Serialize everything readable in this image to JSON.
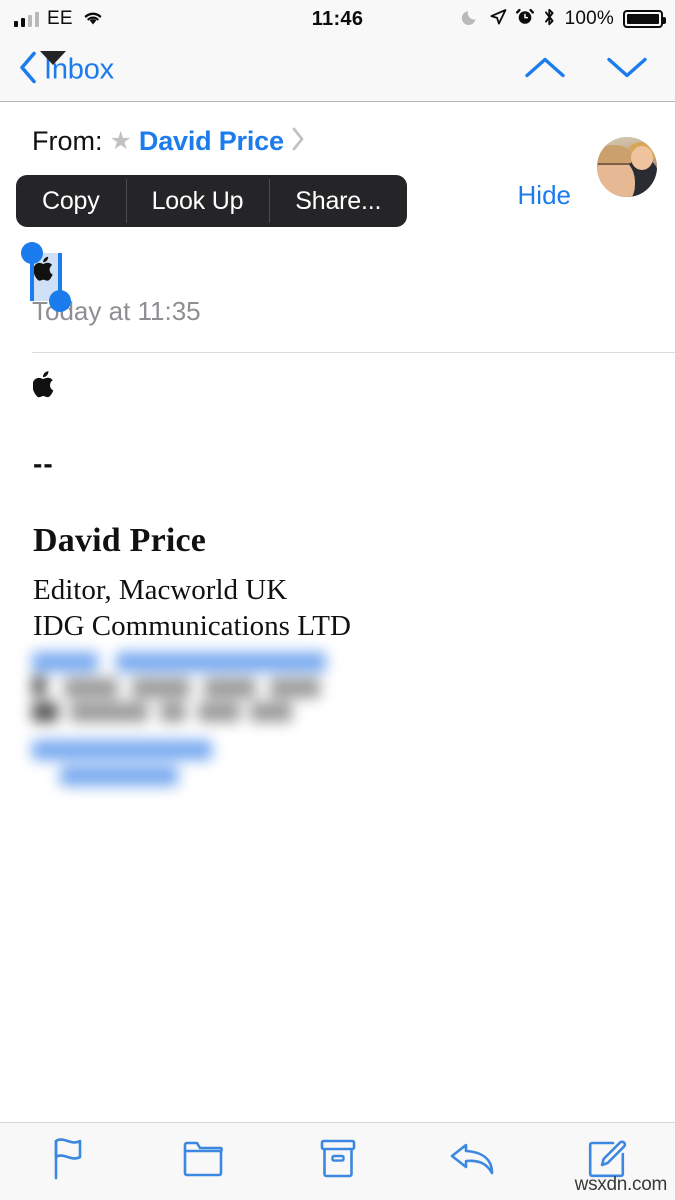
{
  "status_bar": {
    "carrier": "EE",
    "time": "11:46",
    "battery_percent": "100%",
    "icons": {
      "signal": "signal-bars-icon",
      "wifi": "wifi-icon",
      "dnd": "moon-icon",
      "location": "location-arrow-icon",
      "alarm": "alarm-clock-icon",
      "bluetooth": "bluetooth-icon",
      "battery": "battery-icon"
    }
  },
  "nav_bar": {
    "back_label": "Inbox",
    "back_icon": "chevron-left-icon",
    "previous_icon": "chevron-up-icon",
    "next_icon": "chevron-down-icon"
  },
  "header": {
    "from_label": "From:",
    "vip_star": "★",
    "sender_name": "David Price",
    "detail_chevron": "›",
    "hide_label": "Hide",
    "date": "Today at 11:35",
    "avatar_name": "sender-avatar"
  },
  "context_menu": {
    "items": [
      {
        "label": "Copy",
        "name": "copy"
      },
      {
        "label": "Look Up",
        "name": "look-up"
      },
      {
        "label": "Share...",
        "name": "share"
      }
    ]
  },
  "selection": {
    "selected_text": "",
    "handle_color": "#1c7ced",
    "highlight_color": "#cfe0f7"
  },
  "message_body": {
    "glyph": "",
    "separator": "--",
    "signature_name": "David Price",
    "signature_role": "Editor, Macworld UK",
    "signature_company": "IDG Communications LTD"
  },
  "toolbar": {
    "items": [
      {
        "label": "Flag",
        "name": "flag"
      },
      {
        "label": "Move to Folder",
        "name": "folder"
      },
      {
        "label": "Archive",
        "name": "archive"
      },
      {
        "label": "Reply",
        "name": "reply"
      },
      {
        "label": "Compose",
        "name": "compose"
      }
    ]
  },
  "watermark": "wsxdn.com",
  "colors": {
    "accent_blue": "#1c7ced",
    "bar_background": "#f8f8f8",
    "menu_background": "#252527",
    "muted_text": "#8e8e93"
  }
}
